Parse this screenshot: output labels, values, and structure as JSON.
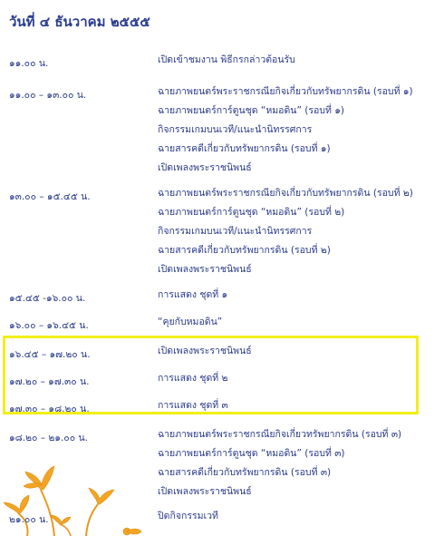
{
  "page": {
    "title": "วันที่ ๔ ธันวาคม ๒๕๕๕"
  },
  "schedule": [
    {
      "time": "๑๑.๐๐ น.",
      "items": [
        "เปิดเข้าชมงาน  พิธีกรกล่าวต้อนรับ"
      ]
    },
    {
      "time": "๑๑.๐๐ – ๑๓.๐๐ น.",
      "items": [
        "ฉายภาพยนตร์พระราชกรณียกิจเกี่ยวกับทรัพยากรดิน (รอบที่ ๑)",
        "ฉายภาพยนตร์การ์ตูนชุด “หมอดิน” (รอบที่ ๑)",
        "กิจกรรมเกมบนเวที/แนะนำนิทรรศการ",
        "ฉายสารคดีเกี่ยวกับทรัพยากรดิน (รอบที่ ๑)",
        "เปิดเพลงพระราชนิพนธ์"
      ]
    },
    {
      "time": "๑๓.๐๐ – ๑๕.๔๕ น.",
      "items": [
        "ฉายภาพยนตร์พระราชกรณียกิจเกี่ยวกับทรัพยากรดิน (รอบที่ ๒)",
        "ฉายภาพยนตร์การ์ตูนชุด  “หมอดิน”  (รอบที่ ๒)",
        "กิจกรรมเกมบนเวที/แนะนำนิทรรศการ",
        "ฉายสารคดีเกี่ยวกับทรัพยากรดิน (รอบที่ ๒)",
        "เปิดเพลงพระราชนิพนธ์"
      ]
    },
    {
      "time": "๑๕.๔๕ -๑๖.๐๐ น.",
      "items": [
        "การแสดง ชุดที่ ๑"
      ]
    },
    {
      "time": "๑๖.๐๐ – ๑๖.๔๕ น.",
      "items": [
        "“คุยกับหมอดิน”"
      ]
    },
    {
      "time": "๑๖.๔๕ – ๑๗.๒๐ น.",
      "items": [
        "เปิดเพลงพระราชนิพนธ์"
      ]
    },
    {
      "time": "๑๗.๒๐ – ๑๗.๓๐ น.",
      "items": [
        "การแสดง ชุดที่ ๒"
      ]
    },
    {
      "time": "๑๗.๓๐ – ๑๘.๒๐ น.",
      "items": [
        "การแสดง ชุดที่ ๓"
      ]
    },
    {
      "time": "๑๘.๒๐ – ๒๑.๐๐ น.",
      "items": [
        "ฉายภาพยนตร์พระราชกรณียกิจเกี่ยวทรัพยากรดิน  (รอบที่ ๓)",
        "ฉายภาพยนตร์การ์ตูนชุด  “หมอดิน”  (รอบที่ ๓)",
        "ฉายสารคดีเกี่ยวกับทรัพยากรดิน  (รอบที่ ๓)",
        "เปิดเพลงพระราชนิพนธ์"
      ]
    },
    {
      "time": "๒๑.๐๐ น.",
      "items": [
        "ปิดกิจกรรมเวที"
      ]
    }
  ],
  "colors": {
    "text": "#2a3a8a",
    "highlight_border": "#f2ee1a",
    "flower": "#f0a020"
  }
}
